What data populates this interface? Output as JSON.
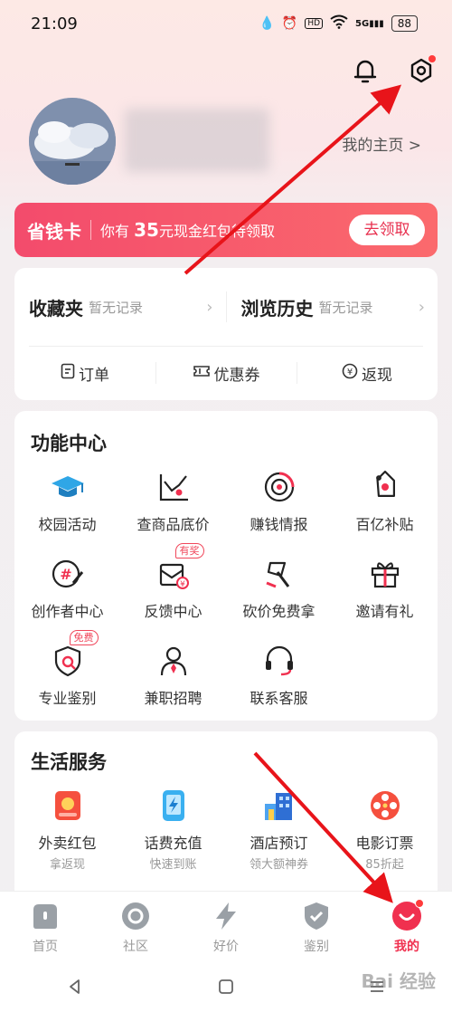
{
  "status_bar": {
    "time": "21:09",
    "battery": "88",
    "network": "5G"
  },
  "profile": {
    "homepage_link": "我的主页 >"
  },
  "savings_card": {
    "title": "省钱卡",
    "desc_prefix": "你有",
    "amount": "35",
    "desc_suffix": "元现金红包待领取",
    "button": "去领取"
  },
  "favorites": {
    "fav_title": "收藏夹",
    "fav_sub": "暂无记录",
    "history_title": "浏览历史",
    "history_sub": "暂无记录",
    "orders": "订单",
    "coupons": "优惠券",
    "cashback": "返现"
  },
  "function_center": {
    "title": "功能中心",
    "items": [
      {
        "label": "校园活动",
        "icon": "graduation-cap-icon"
      },
      {
        "label": "查商品底价",
        "icon": "price-chart-icon"
      },
      {
        "label": "赚钱情报",
        "icon": "target-icon"
      },
      {
        "label": "百亿补贴",
        "icon": "tag-icon"
      },
      {
        "label": "创作者中心",
        "icon": "creator-hash-icon"
      },
      {
        "label": "反馈中心",
        "icon": "feedback-icon",
        "badge": "有奖"
      },
      {
        "label": "砍价免费拿",
        "icon": "axe-icon"
      },
      {
        "label": "邀请有礼",
        "icon": "gift-icon"
      },
      {
        "label": "专业鉴别",
        "icon": "shield-check-icon",
        "badge": "免费"
      },
      {
        "label": "兼职招聘",
        "icon": "person-tie-icon"
      },
      {
        "label": "联系客服",
        "icon": "headset-icon"
      }
    ]
  },
  "life_services": {
    "title": "生活服务",
    "items": [
      {
        "label": "外卖红包",
        "sub": "拿返现",
        "icon": "food-coupon-icon"
      },
      {
        "label": "话费充值",
        "sub": "快速到账",
        "icon": "phone-charge-icon"
      },
      {
        "label": "酒店预订",
        "sub": "领大额神券",
        "icon": "hotel-icon"
      },
      {
        "label": "电影订票",
        "sub": "85折起",
        "icon": "film-reel-icon"
      }
    ]
  },
  "bottom_nav": [
    {
      "label": "首页",
      "icon": "home-icon"
    },
    {
      "label": "社区",
      "icon": "community-icon"
    },
    {
      "label": "好价",
      "icon": "lightning-icon"
    },
    {
      "label": "鉴别",
      "icon": "shield-icon"
    },
    {
      "label": "我的",
      "icon": "me-icon",
      "active": true
    }
  ],
  "watermark": "Bai 经验",
  "colors": {
    "accent": "#f0304f",
    "arrow": "#e8141a"
  }
}
